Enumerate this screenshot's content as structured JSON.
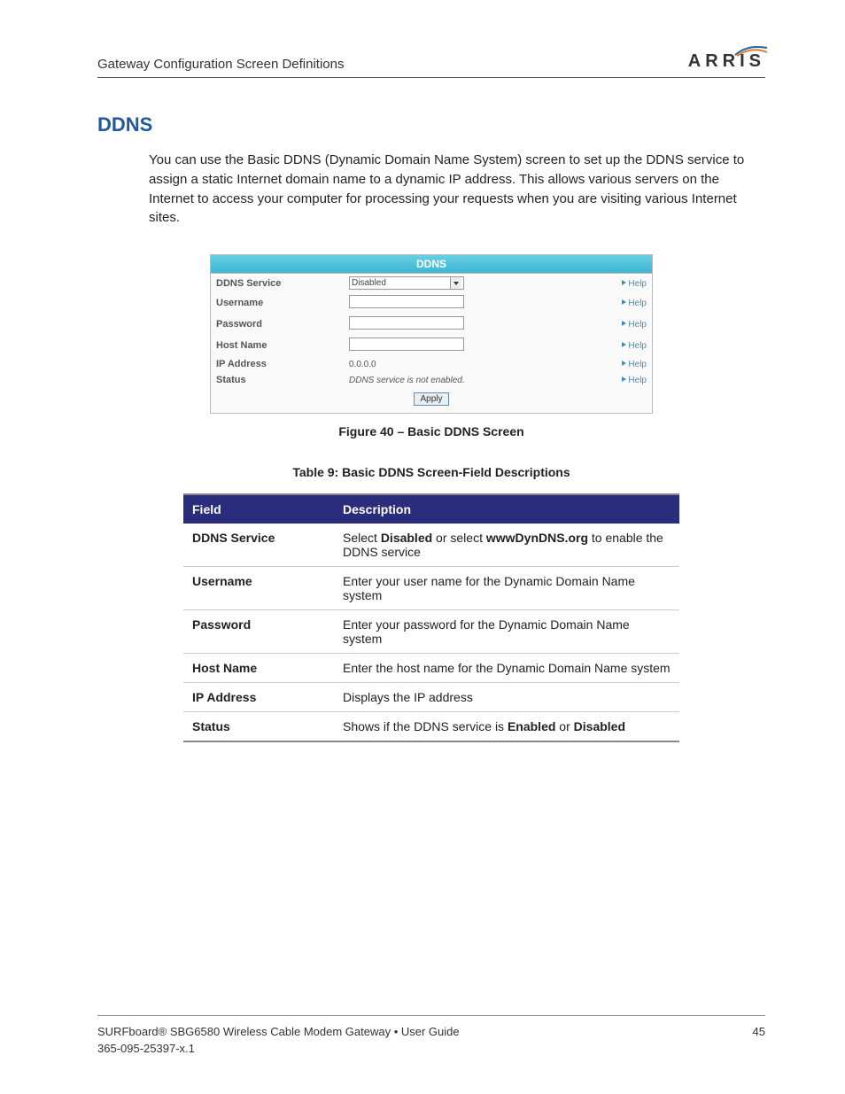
{
  "header": {
    "running_title": "Gateway Configuration Screen Definitions",
    "brand": "ARRIS"
  },
  "section": {
    "heading": "DDNS",
    "paragraph": "You can use the Basic DDNS (Dynamic Domain Name System) screen to set up the DDNS service to assign a static Internet domain name to a dynamic IP address. This allows various servers on the Internet to access your computer for processing your requests when you are visiting various Internet sites."
  },
  "panel": {
    "title": "DDNS",
    "rows": {
      "service_label": "DDNS Service",
      "service_value": "Disabled",
      "username_label": "Username",
      "password_label": "Password",
      "hostname_label": "Host Name",
      "ip_label": "IP Address",
      "ip_value": "0.0.0.0",
      "status_label": "Status",
      "status_value": "DDNS service is not enabled."
    },
    "help_label": "Help",
    "apply_label": "Apply"
  },
  "captions": {
    "figure": "Figure 40 – Basic DDNS Screen",
    "table": "Table 9: Basic DDNS Screen-Field Descriptions"
  },
  "table": {
    "head_field": "Field",
    "head_desc": "Description",
    "r1f": "DDNS Service",
    "r1d_pre": "Select ",
    "r1d_b1": "Disabled",
    "r1d_mid": " or select ",
    "r1d_b2": "wwwDynDNS.org",
    "r1d_post": " to enable the DDNS service",
    "r2f": "Username",
    "r2d": "Enter your user name for the Dynamic Domain Name system",
    "r3f": "Password",
    "r3d": "Enter your password for the Dynamic Domain Name system",
    "r4f": "Host Name",
    "r4d": "Enter the host name for the Dynamic Domain Name system",
    "r5f": "IP Address",
    "r5d": "Displays the IP address",
    "r6f": "Status",
    "r6d_pre": "Shows if the DDNS service is ",
    "r6d_b1": "Enabled",
    "r6d_mid": " or ",
    "r6d_b2": "Disabled"
  },
  "footer": {
    "line1": "SURFboard® SBG6580 Wireless Cable Modem Gateway • User Guide",
    "page": "45",
    "line2": "365-095-25397-x.1"
  }
}
